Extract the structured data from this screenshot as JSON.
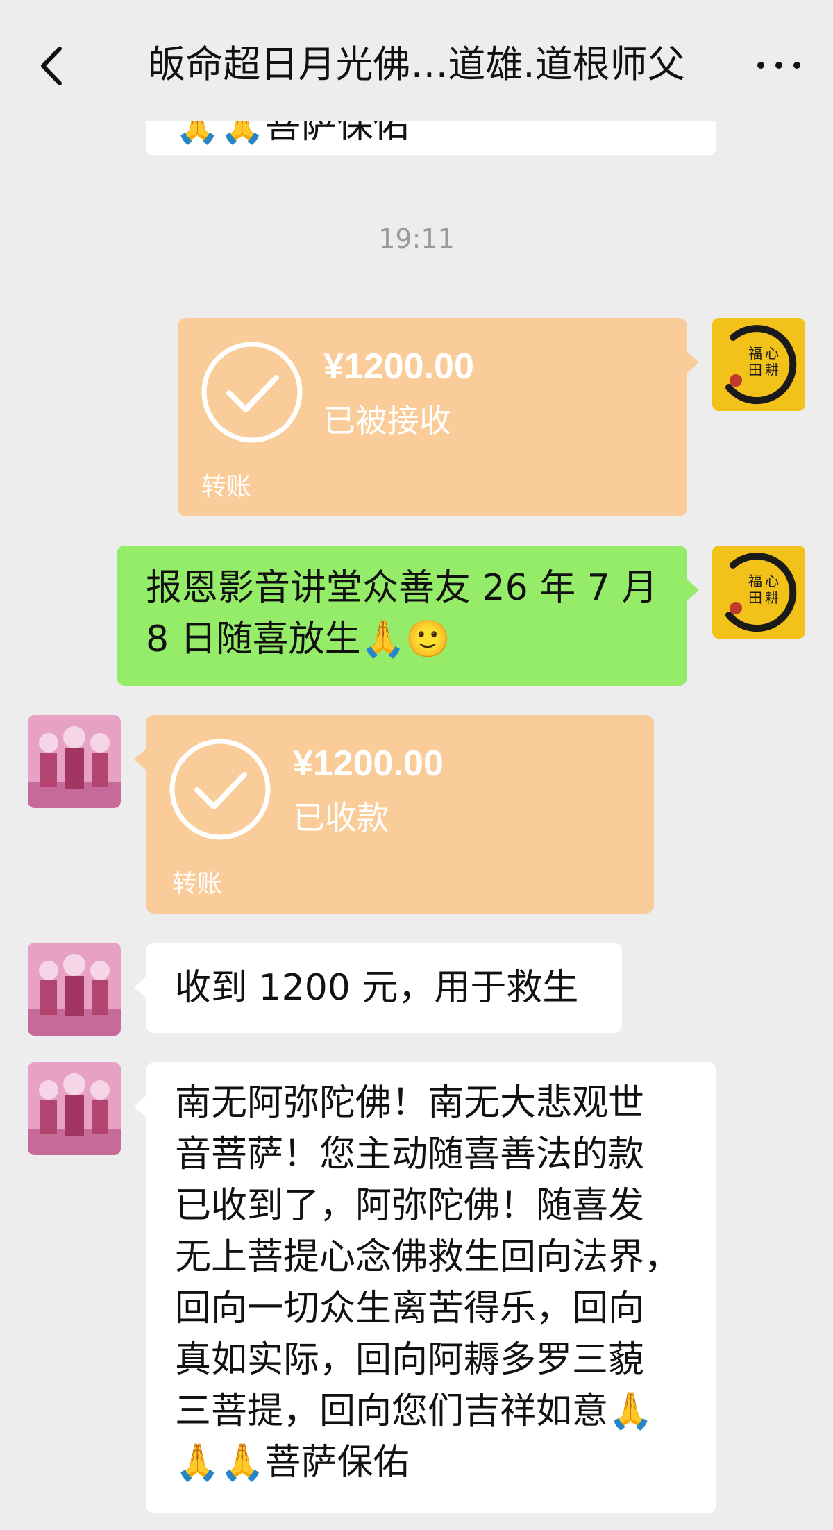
{
  "header": {
    "title": "皈命超日月光佛…道雄.道根师父",
    "back_icon": "back-chevron-icon",
    "more_icon": "more-dots-icon"
  },
  "messages": {
    "partial_top": {
      "text": "🙏🙏菩萨保佑"
    },
    "timestamp": "19:11",
    "transfer_sent": {
      "amount": "¥1200.00",
      "status": "已被接收",
      "label": "转账"
    },
    "green_msg": {
      "line1": "报恩影音讲堂众善友 26 年 7 月",
      "line2": "8 日随喜放生🙏🙂"
    },
    "transfer_received": {
      "amount": "¥1200.00",
      "status": "已收款",
      "label": "转账"
    },
    "reply_short": {
      "text": "收到 1200 元，用于救生"
    },
    "reply_long": {
      "lines": [
        "南无阿弥陀佛！南无大悲观世",
        "音菩萨！您主动随喜善法的款",
        "已收到了，阿弥陀佛！随喜发",
        "无上菩提心念佛救生回向法界，",
        "回向一切众生离苦得乐，回向",
        "真如实际，回向阿耨多罗三藐",
        "三菩提，回向您们吉祥如意🙏",
        "🙏🙏菩萨保佑"
      ]
    }
  },
  "colors": {
    "background": "#ededed",
    "green_bubble": "#95ec69",
    "transfer_bubble": "#f9cc9a",
    "white_bubble": "#ffffff"
  },
  "avatars": {
    "mine": {
      "text": "福田心耕"
    },
    "other": {
      "icon": "buddha-image-icon"
    }
  }
}
